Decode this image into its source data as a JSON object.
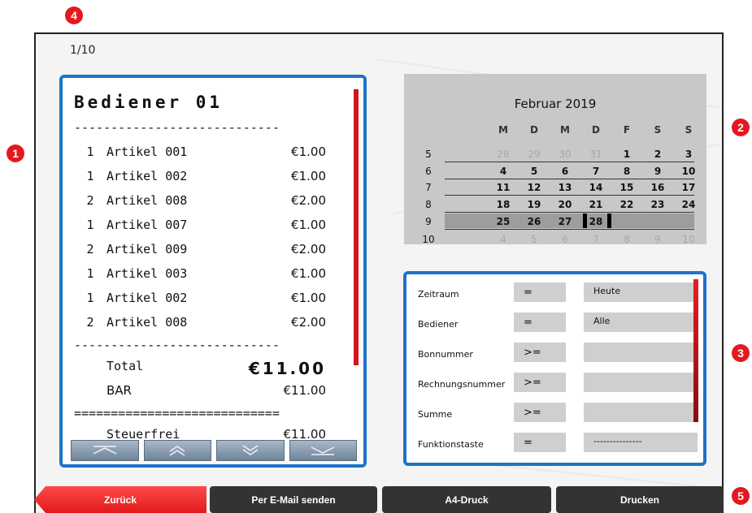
{
  "badges": [
    "1",
    "2",
    "3",
    "4",
    "5"
  ],
  "page_indicator": "1/10",
  "receipt": {
    "title": "Bediener 01",
    "separator_dash": "----------------------------",
    "separator_eq": "============================",
    "items": [
      {
        "qty": "1",
        "name": "Artikel 001",
        "price": "€1.00"
      },
      {
        "qty": "1",
        "name": "Artikel 002",
        "price": "€1.00"
      },
      {
        "qty": "2",
        "name": "Artikel 008",
        "price": "€2.00"
      },
      {
        "qty": "1",
        "name": "Artikel 007",
        "price": "€1.00"
      },
      {
        "qty": "2",
        "name": "Artikel 009",
        "price": "€2.00"
      },
      {
        "qty": "1",
        "name": "Artikel 003",
        "price": "€1.00"
      },
      {
        "qty": "1",
        "name": "Artikel 002",
        "price": "€1.00"
      },
      {
        "qty": "2",
        "name": "Artikel 008",
        "price": "€2.00"
      }
    ],
    "total_label": "Total",
    "total_value": "€11.00",
    "payment_label": "BAR",
    "payment_value": "€11.00",
    "cut_label": "Steuerfrei",
    "cut_value": "€11.00"
  },
  "nav_buttons": [
    {
      "name": "scroll-top-button",
      "icon": "chevron-bar-up-icon"
    },
    {
      "name": "page-up-button",
      "icon": "double-chevron-up-icon"
    },
    {
      "name": "page-down-button",
      "icon": "double-chevron-down-icon"
    },
    {
      "name": "scroll-bottom-button",
      "icon": "chevron-bar-down-icon"
    }
  ],
  "calendar": {
    "title": "Februar 2019",
    "weekdays": [
      "M",
      "D",
      "M",
      "D",
      "F",
      "S",
      "S"
    ],
    "weeks": [
      {
        "wk": "5",
        "days": [
          "28",
          "29",
          "30",
          "31",
          "1",
          "2",
          "3"
        ],
        "muted": [
          0,
          1,
          2,
          3
        ]
      },
      {
        "wk": "6",
        "days": [
          "4",
          "5",
          "6",
          "7",
          "8",
          "9",
          "10"
        ],
        "muted": []
      },
      {
        "wk": "7",
        "days": [
          "11",
          "12",
          "13",
          "14",
          "15",
          "16",
          "17"
        ],
        "muted": []
      },
      {
        "wk": "8",
        "days": [
          "18",
          "19",
          "20",
          "21",
          "22",
          "23",
          "24"
        ],
        "muted": []
      },
      {
        "wk": "9",
        "days": [
          "25",
          "26",
          "27",
          "28",
          "",
          "",
          ""
        ],
        "muted": []
      },
      {
        "wk": "10",
        "days": [
          "4",
          "5",
          "6",
          "7",
          "8",
          "9",
          "10"
        ],
        "muted": [
          0,
          1,
          2,
          3,
          4,
          5,
          6
        ]
      }
    ],
    "selected_day": "28"
  },
  "filters": [
    {
      "label": "Zeitraum",
      "op": "=",
      "value": "Heute"
    },
    {
      "label": "Bediener",
      "op": "=",
      "value": "Alle"
    },
    {
      "label": "Bonnummer",
      "op": ">=",
      "value": ""
    },
    {
      "label": "Rechnungsnummer",
      "op": ">=",
      "value": ""
    },
    {
      "label": "Summe",
      "op": ">=",
      "value": ""
    },
    {
      "label": "Funktionstaste",
      "op": "=",
      "value": "---------------"
    }
  ],
  "bottom_buttons": {
    "back": "Zurück",
    "email": "Per E-Mail senden",
    "a4": "A4-Druck",
    "print": "Drucken"
  },
  "colors": {
    "accent_blue": "#1e73c8",
    "badge_red": "#e3191f",
    "scrollbar_red": "#d2161c",
    "button_dark": "#333333"
  }
}
